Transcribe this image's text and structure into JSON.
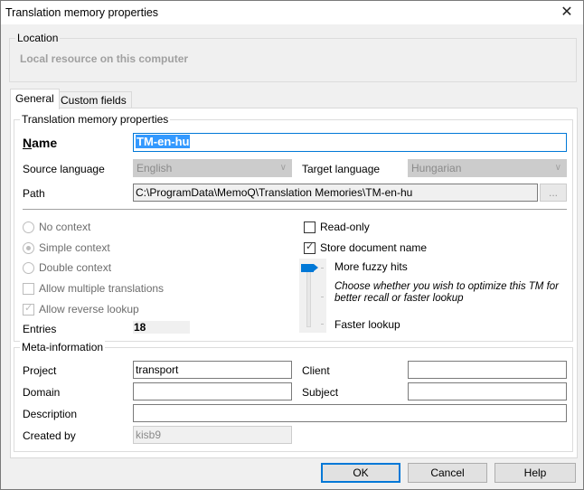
{
  "window": {
    "title": "Translation memory properties",
    "close_icon": "close-icon"
  },
  "location": {
    "legend": "Location",
    "value": "Local resource on this computer"
  },
  "tabs": [
    {
      "label": "General",
      "active": true
    },
    {
      "label": "Custom fields",
      "active": false
    }
  ],
  "tm_properties": {
    "legend": "Translation memory properties",
    "name_label": "Name",
    "name_value": "TM-en-hu",
    "source_language_label": "Source language",
    "source_language_value": "English",
    "target_language_label": "Target language",
    "target_language_value": "Hungarian",
    "path_label": "Path",
    "path_value": "C:\\ProgramData\\MemoQ\\Translation Memories\\TM-en-hu",
    "browse_label": "..."
  },
  "context": {
    "options": [
      {
        "label": "No context",
        "selected": false
      },
      {
        "label": "Simple context",
        "selected": true
      },
      {
        "label": "Double context",
        "selected": false
      }
    ],
    "allow_multiple_label": "Allow multiple translations",
    "allow_multiple_checked": false,
    "allow_reverse_label": "Allow reverse lookup",
    "allow_reverse_checked": true,
    "entries_label": "Entries",
    "entries_value": "18"
  },
  "options": {
    "read_only_label": "Read-only",
    "read_only_checked": false,
    "store_doc_label": "Store document name",
    "store_doc_checked": true,
    "slider_top_label": "More fuzzy hits",
    "slider_hint": "Choose whether you wish to optimize this TM for better recall or faster lookup",
    "slider_bottom_label": "Faster lookup",
    "slider_position": "More fuzzy hits"
  },
  "meta": {
    "legend": "Meta-information",
    "project_label": "Project",
    "project_value": "transport",
    "client_label": "Client",
    "client_value": "",
    "domain_label": "Domain",
    "domain_value": "",
    "subject_label": "Subject",
    "subject_value": "",
    "description_label": "Description",
    "description_value": "",
    "created_by_label": "Created by",
    "created_by_value": "kisb9"
  },
  "buttons": {
    "ok": "OK",
    "cancel": "Cancel",
    "help": "Help"
  }
}
